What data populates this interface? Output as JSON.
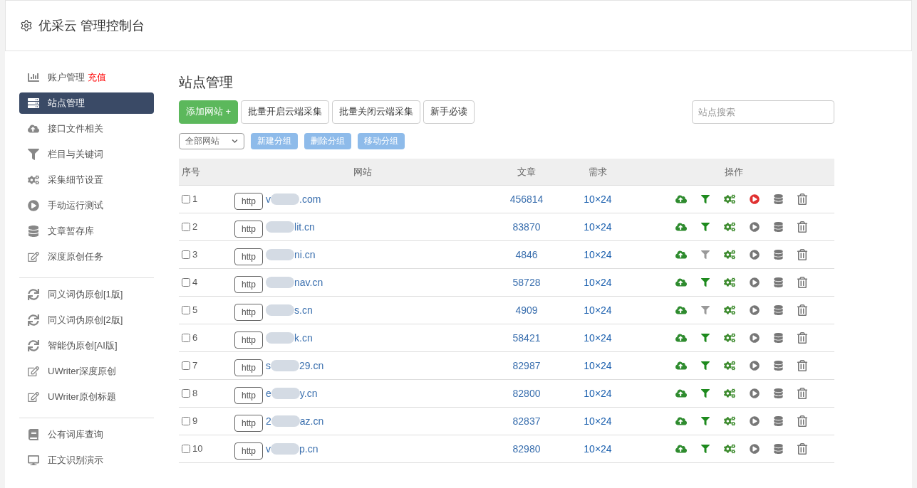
{
  "header": {
    "title": "优采云 管理控制台"
  },
  "sidebar": {
    "groups": [
      [
        {
          "label": "账户管理",
          "badge": "充值",
          "selected": false
        },
        {
          "label": "站点管理",
          "selected": true
        },
        {
          "label": "接口文件相关",
          "selected": false
        },
        {
          "label": "栏目与关键词",
          "selected": false
        },
        {
          "label": "采集细节设置",
          "selected": false
        },
        {
          "label": "手动运行测试",
          "selected": false
        },
        {
          "label": "文章暂存库",
          "selected": false
        },
        {
          "label": "深度原创任务",
          "selected": false
        }
      ],
      [
        {
          "label": "同义词伪原创[1版]",
          "selected": false
        },
        {
          "label": "同义词伪原创[2版]",
          "selected": false
        },
        {
          "label": "智能伪原创[AI版]",
          "selected": false
        },
        {
          "label": "UWriter深度原创",
          "selected": false
        },
        {
          "label": "UWriter原创标题",
          "selected": false
        }
      ],
      [
        {
          "label": "公有词库查询",
          "selected": false
        },
        {
          "label": "正文识别演示",
          "selected": false
        }
      ]
    ]
  },
  "page_title": "站点管理",
  "actions": [
    {
      "label": "添加网站 +",
      "kind": "primary"
    },
    {
      "label": "批量开启云端采集",
      "kind": "default"
    },
    {
      "label": "批量关闭云端采集",
      "kind": "default"
    },
    {
      "label": "新手必读",
      "kind": "default"
    }
  ],
  "search": {
    "placeholder": "站点搜索"
  },
  "group_select": {
    "value": "全部网站"
  },
  "group_buttons": [
    "新建分组",
    "删除分组",
    "移动分组"
  ],
  "table": {
    "columns": [
      "序号",
      "网站",
      "文章",
      "需求",
      "操作"
    ],
    "rows": [
      {
        "index": "1",
        "checked": false,
        "protocol": "http",
        "site_start": "v",
        "site_end": ".com",
        "articles": "456814",
        "demand": "10×24",
        "filter_on": true,
        "running": true
      },
      {
        "index": "2",
        "checked": false,
        "protocol": "http",
        "site_start": "",
        "site_end": "lit.cn",
        "articles": "83870",
        "demand": "10×24",
        "filter_on": true,
        "running": false
      },
      {
        "index": "3",
        "checked": false,
        "protocol": "http",
        "site_start": "",
        "site_end": "ni.cn",
        "articles": "4846",
        "demand": "10×24",
        "filter_on": false,
        "running": false
      },
      {
        "index": "4",
        "checked": false,
        "protocol": "http",
        "site_start": "",
        "site_end": "nav.cn",
        "articles": "58728",
        "demand": "10×24",
        "filter_on": true,
        "running": false
      },
      {
        "index": "5",
        "checked": false,
        "protocol": "http",
        "site_start": "",
        "site_end": "s.cn",
        "articles": "4909",
        "demand": "10×24",
        "filter_on": false,
        "running": false
      },
      {
        "index": "6",
        "checked": false,
        "protocol": "http",
        "site_start": "",
        "site_end": "k.cn",
        "articles": "58421",
        "demand": "10×24",
        "filter_on": true,
        "running": false
      },
      {
        "index": "7",
        "checked": false,
        "protocol": "http",
        "site_start": "s",
        "site_end": "29.cn",
        "articles": "82987",
        "demand": "10×24",
        "filter_on": true,
        "running": false
      },
      {
        "index": "8",
        "checked": false,
        "protocol": "http",
        "site_start": "e",
        "site_end": "y.cn",
        "articles": "82800",
        "demand": "10×24",
        "filter_on": true,
        "running": false
      },
      {
        "index": "9",
        "checked": false,
        "protocol": "http",
        "site_start": "2",
        "site_end": "az.cn",
        "articles": "82837",
        "demand": "10×24",
        "filter_on": true,
        "running": false
      },
      {
        "index": "10",
        "checked": false,
        "protocol": "http",
        "site_start": "v",
        "site_end": "p.cn",
        "articles": "82980",
        "demand": "10×24",
        "filter_on": true,
        "running": false
      }
    ]
  }
}
